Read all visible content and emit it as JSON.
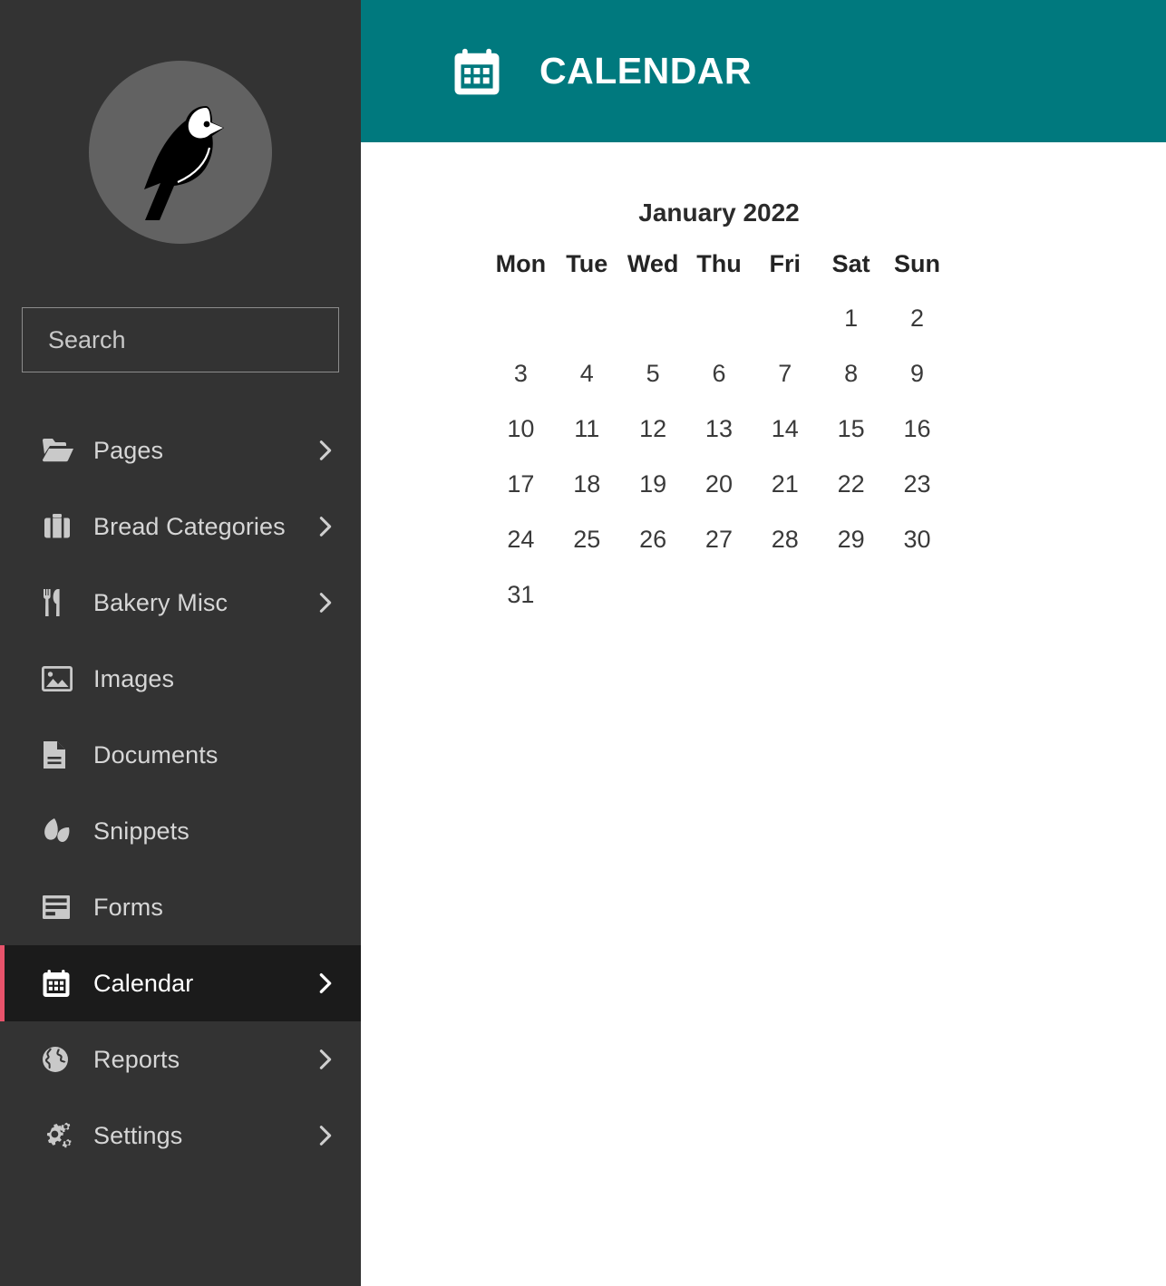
{
  "sidebar": {
    "logo": {
      "icon": "bird-logo",
      "circle_color": "#626262"
    },
    "search": {
      "placeholder": "Search",
      "value": "",
      "icon": "search-icon"
    },
    "items": [
      {
        "label": "Pages",
        "icon": "folder-open-icon",
        "has_arrow": true,
        "active": false
      },
      {
        "label": "Bread Categories",
        "icon": "briefcase-icon",
        "has_arrow": true,
        "active": false
      },
      {
        "label": "Bakery Misc",
        "icon": "cutlery-icon",
        "has_arrow": true,
        "active": false
      },
      {
        "label": "Images",
        "icon": "image-icon",
        "has_arrow": false,
        "active": false
      },
      {
        "label": "Documents",
        "icon": "document-icon",
        "has_arrow": false,
        "active": false
      },
      {
        "label": "Snippets",
        "icon": "leaf-icon",
        "has_arrow": false,
        "active": false
      },
      {
        "label": "Forms",
        "icon": "forms-icon",
        "has_arrow": false,
        "active": false
      },
      {
        "label": "Calendar",
        "icon": "calendar-icon",
        "has_arrow": true,
        "active": true
      },
      {
        "label": "Reports",
        "icon": "globe-icon",
        "has_arrow": true,
        "active": false
      },
      {
        "label": "Settings",
        "icon": "gears-icon",
        "has_arrow": true,
        "active": false
      }
    ]
  },
  "header": {
    "title": "CALENDAR",
    "icon": "calendar-icon",
    "background_color": "#00797E",
    "text_color": "#FFFFFF"
  },
  "calendar": {
    "month_title": "January 2022",
    "month": "January",
    "year": "2022",
    "weekdays": [
      "Mon",
      "Tue",
      "Wed",
      "Thu",
      "Fri",
      "Sat",
      "Sun"
    ],
    "weeks": [
      [
        "",
        "",
        "",
        "",
        "",
        "1",
        "2"
      ],
      [
        "3",
        "4",
        "5",
        "6",
        "7",
        "8",
        "9"
      ],
      [
        "10",
        "11",
        "12",
        "13",
        "14",
        "15",
        "16"
      ],
      [
        "17",
        "18",
        "19",
        "20",
        "21",
        "22",
        "23"
      ],
      [
        "24",
        "25",
        "26",
        "27",
        "28",
        "29",
        "30"
      ],
      [
        "31",
        "",
        "",
        "",
        "",
        "",
        ""
      ]
    ]
  },
  "colors": {
    "sidebar_bg": "#333333",
    "sidebar_active_bg": "#1B1B1B",
    "sidebar_active_marker": "#E8536B",
    "accent_teal": "#00797E",
    "content_bg": "#FFFFFF"
  }
}
